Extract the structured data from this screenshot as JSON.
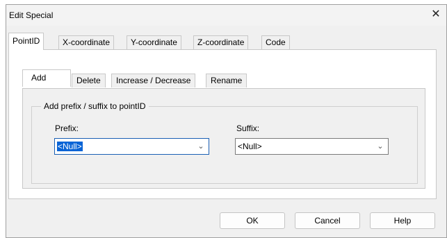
{
  "dialog": {
    "title": "Edit Special",
    "close_glyph": "✕"
  },
  "outer_tabs": [
    "PointID",
    "X-coordinate",
    "Y-coordinate",
    "Z-coordinate",
    "Code"
  ],
  "inner_tabs": [
    "Add",
    "Delete",
    "Increase / Decrease",
    "Rename"
  ],
  "group": {
    "legend": "Add prefix / suffix to pointID",
    "prefix_label": "Prefix:",
    "prefix_value": "<Null>",
    "suffix_label": "Suffix:",
    "suffix_value": "<Null>"
  },
  "buttons": {
    "ok": "OK",
    "cancel": "Cancel",
    "help": "Help"
  },
  "icons": {
    "close": "close-icon",
    "dropdown": "chevron-down-icon"
  }
}
